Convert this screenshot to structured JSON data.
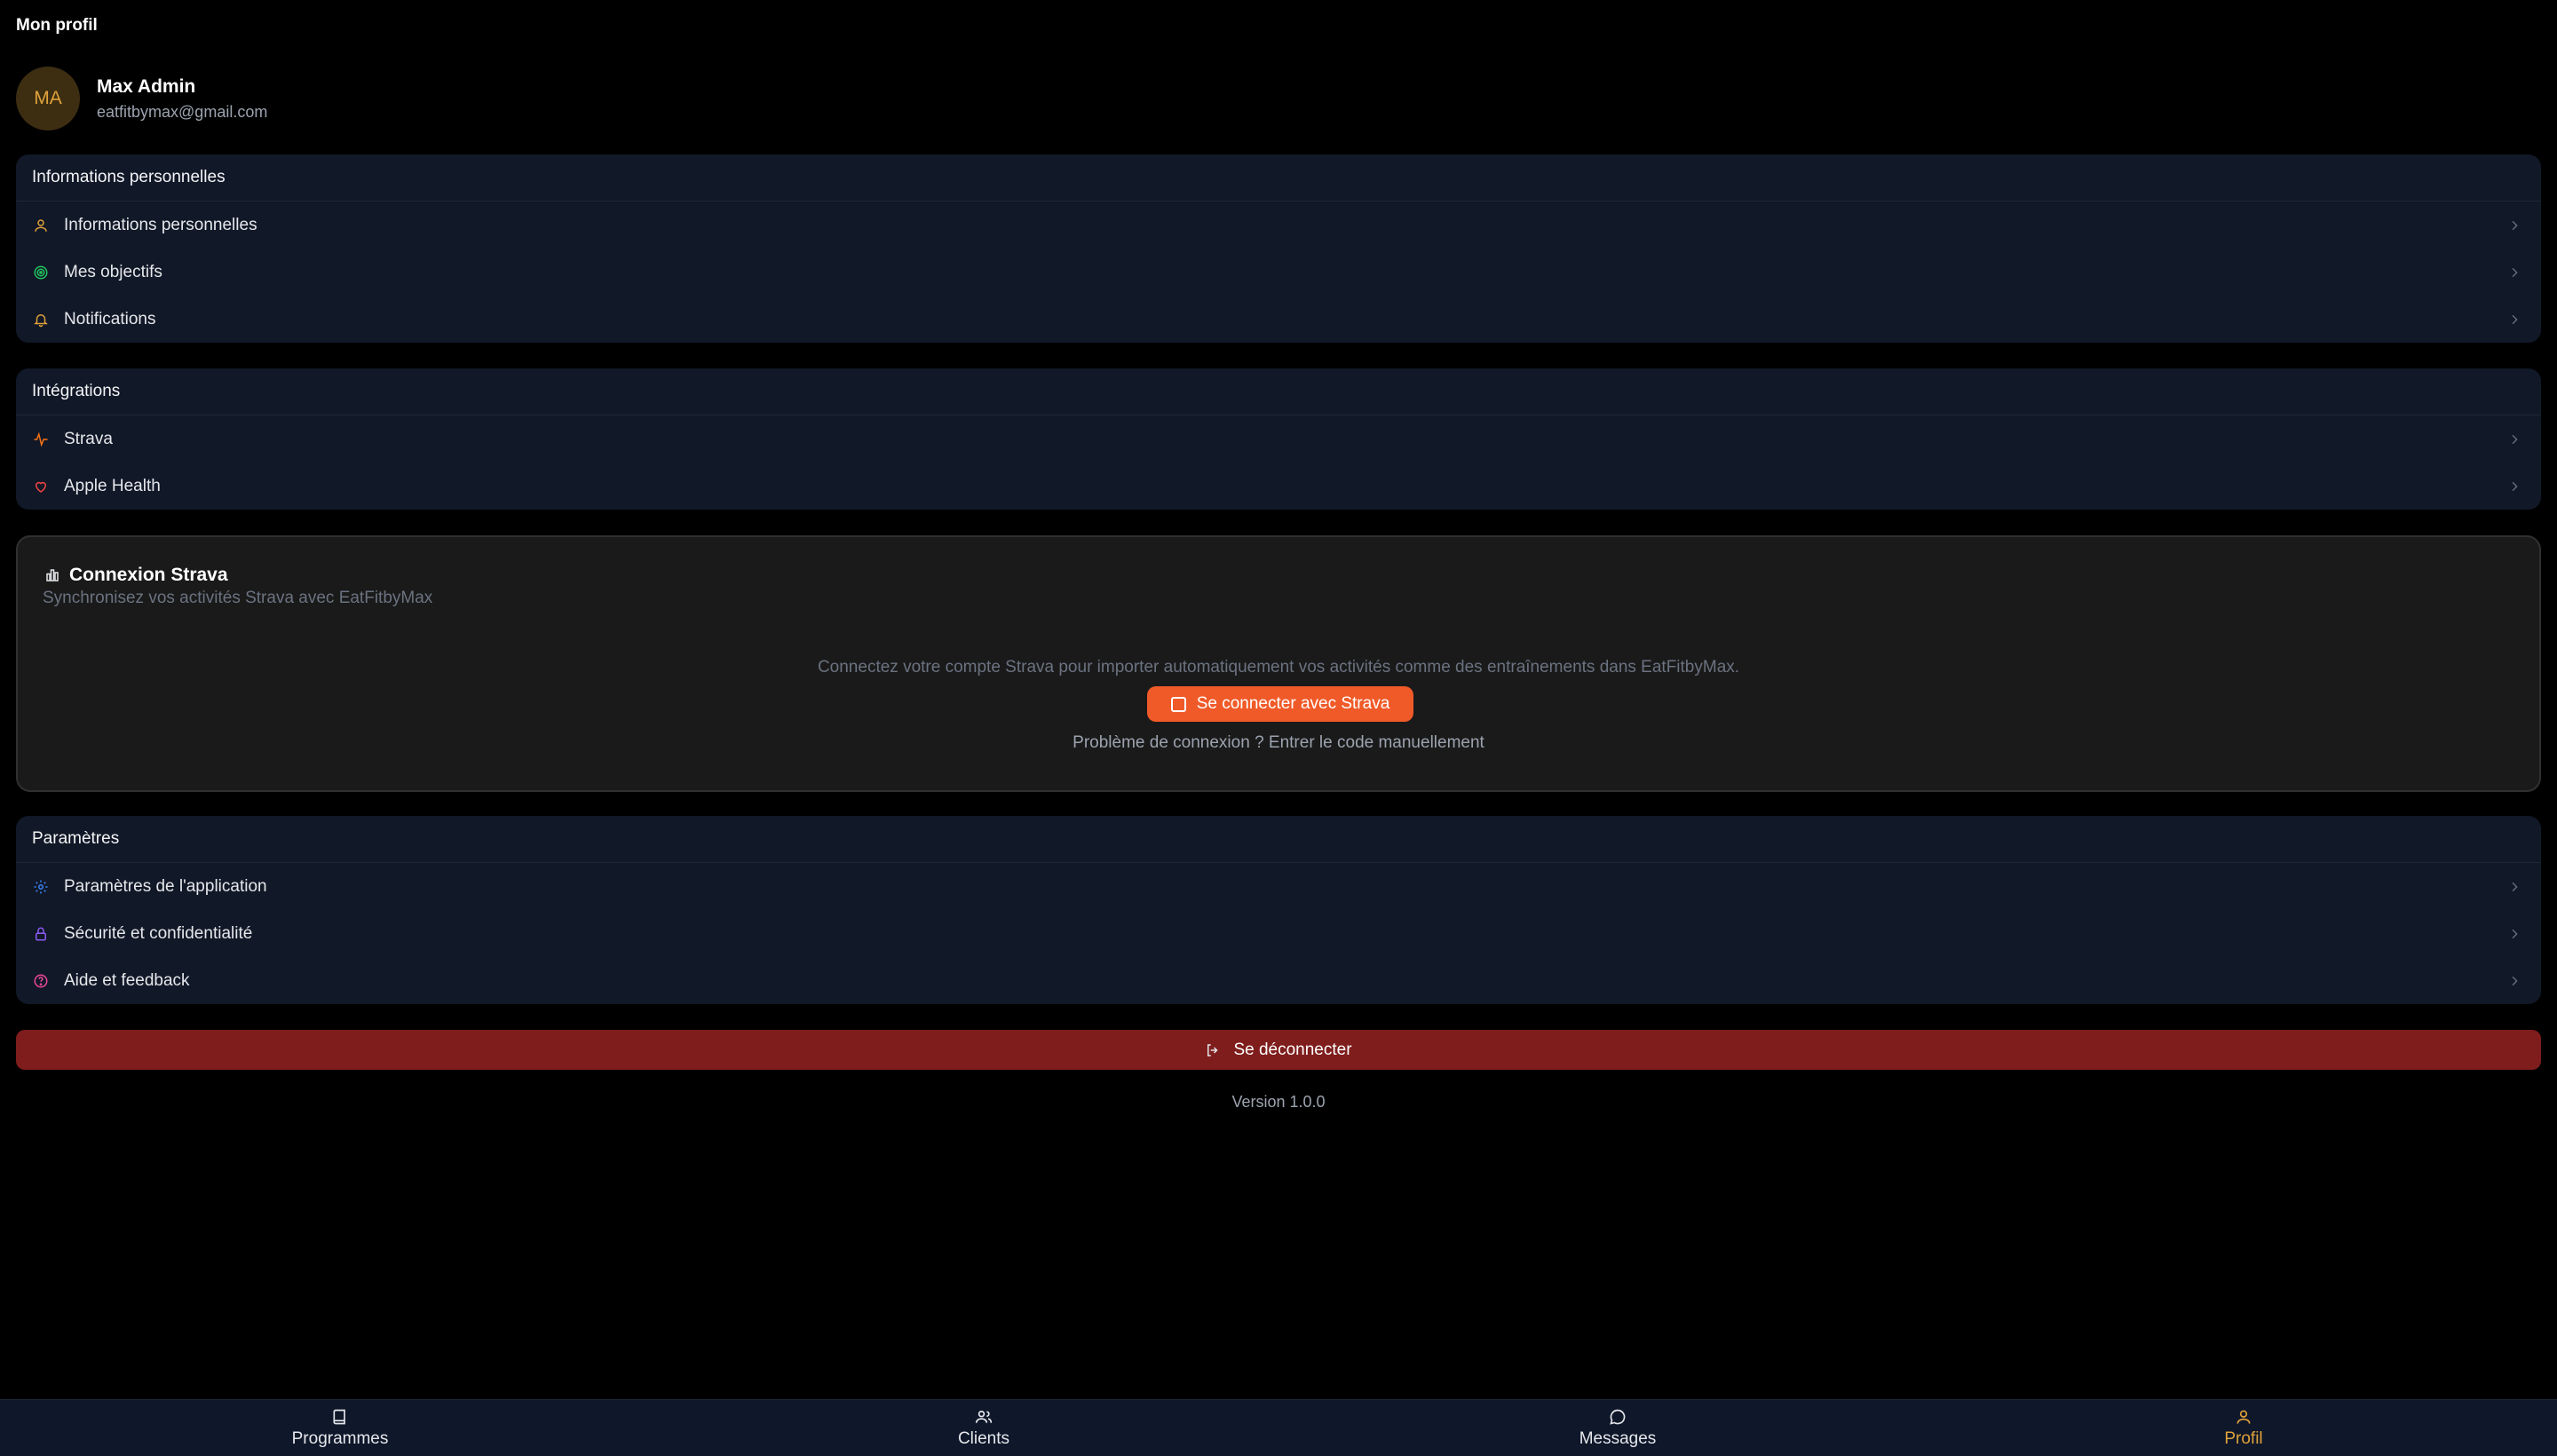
{
  "page": {
    "title": "Mon profil"
  },
  "profile": {
    "initials": "MA",
    "name": "Max Admin",
    "email": "eatfitbymax@gmail.com"
  },
  "sections": {
    "personal": {
      "header": "Informations personnelles",
      "items": [
        {
          "label": "Informations personnelles",
          "icon": "user-icon",
          "color": "#e0a23a"
        },
        {
          "label": "Mes objectifs",
          "icon": "target-icon",
          "color": "#22c55e"
        },
        {
          "label": "Notifications",
          "icon": "bell-icon",
          "color": "#e0a23a"
        }
      ]
    },
    "integrations": {
      "header": "Intégrations",
      "items": [
        {
          "label": "Strava",
          "icon": "activity-icon",
          "color": "#f97316"
        },
        {
          "label": "Apple Health",
          "icon": "heart-icon",
          "color": "#ef4444"
        }
      ]
    },
    "settings": {
      "header": "Paramètres",
      "items": [
        {
          "label": "Paramètres de l'application",
          "icon": "gear-icon",
          "color": "#3b82f6"
        },
        {
          "label": "Sécurité et confidentialité",
          "icon": "lock-icon",
          "color": "#8b5cf6"
        },
        {
          "label": "Aide et feedback",
          "icon": "help-icon",
          "color": "#ec4899"
        }
      ]
    }
  },
  "strava": {
    "title": "Connexion Strava",
    "subtitle": "Synchronisez vos activités Strava avec EatFitbyMax",
    "description": "Connectez votre compte Strava pour importer automatiquement vos activités comme des entraînements dans EatFitbyMax.",
    "connect_label": "Se connecter avec Strava",
    "manual_label": "Problème de connexion ? Entrer le code manuellement",
    "accent": "#f05a28"
  },
  "logout": {
    "label": "Se déconnecter",
    "color": "#7f1d1d"
  },
  "version": "Version 1.0.0",
  "tabbar": {
    "tabs": [
      {
        "label": "Programmes",
        "icon": "book-icon",
        "active": false
      },
      {
        "label": "Clients",
        "icon": "users-icon",
        "active": false
      },
      {
        "label": "Messages",
        "icon": "chat-icon",
        "active": false
      },
      {
        "label": "Profil",
        "icon": "user-icon",
        "active": true
      }
    ],
    "active_color": "#e0a23a"
  }
}
